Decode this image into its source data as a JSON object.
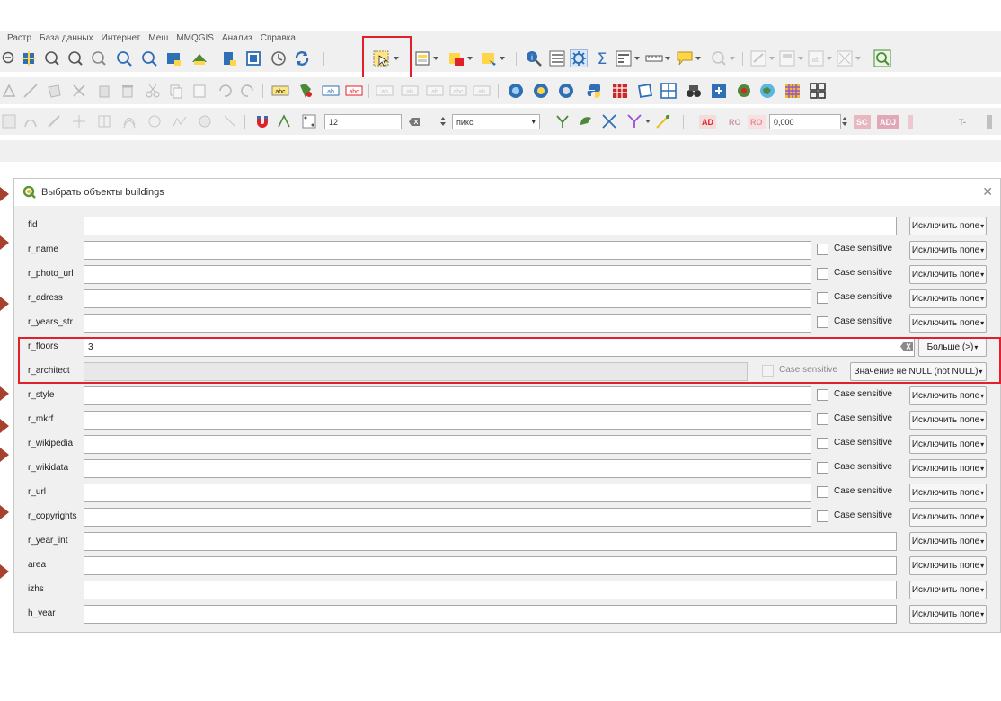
{
  "menubar": {
    "items": [
      "Растр",
      "База данных",
      "Интернет",
      "Меш",
      "MMQGIS",
      "Анализ",
      "Справка"
    ]
  },
  "toolbar": {
    "snapping_tolerance": "12",
    "snapping_units": "пикс",
    "label_ad": "AD",
    "label_ro": "RO",
    "label_sc": "SC",
    "label_adj": "ADJ",
    "label_tn": "T-",
    "rotation_value": "0,000"
  },
  "colors": {
    "accent_red": "#e0202a",
    "qgis_green": "#589632",
    "dock_marker": "#a5412c"
  },
  "dialog": {
    "title": "Выбрать объекты buildings",
    "close_icon": "close-icon",
    "fields": [
      {
        "name": "fid",
        "value": "",
        "case": "",
        "button": "Исключить поле"
      },
      {
        "name": "r_name",
        "value": "",
        "case": "Case sensitive",
        "button": "Исключить поле"
      },
      {
        "name": "r_photo_url",
        "value": "",
        "case": "Case sensitive",
        "button": "Исключить поле"
      },
      {
        "name": "r_adress",
        "value": "",
        "case": "Case sensitive",
        "button": "Исключить поле"
      },
      {
        "name": "r_years_str",
        "value": "",
        "case": "Case sensitive",
        "button": "Исключить поле"
      },
      {
        "name": "r_floors",
        "value": "3",
        "case": "",
        "button": "Больше (>)"
      },
      {
        "name": "r_architect",
        "value": "",
        "case": "Case sensitive",
        "button": "Значение не NULL (not NULL)"
      },
      {
        "name": "r_style",
        "value": "",
        "case": "Case sensitive",
        "button": "Исключить поле"
      },
      {
        "name": "r_mkrf",
        "value": "",
        "case": "Case sensitive",
        "button": "Исключить поле"
      },
      {
        "name": "r_wikipedia",
        "value": "",
        "case": "Case sensitive",
        "button": "Исключить поле"
      },
      {
        "name": "r_wikidata",
        "value": "",
        "case": "Case sensitive",
        "button": "Исключить поле"
      },
      {
        "name": "r_url",
        "value": "",
        "case": "Case sensitive",
        "button": "Исключить поле"
      },
      {
        "name": "r_copyrights",
        "value": "",
        "case": "Case sensitive",
        "button": "Исключить поле"
      },
      {
        "name": "r_year_int",
        "value": "",
        "case": "",
        "button": "Исключить поле"
      },
      {
        "name": "area",
        "value": "",
        "case": "",
        "button": "Исключить поле"
      },
      {
        "name": "izhs",
        "value": "",
        "case": "",
        "button": "Исключить поле"
      },
      {
        "name": "h_year",
        "value": "",
        "case": "",
        "button": "Исключить поле"
      }
    ]
  }
}
